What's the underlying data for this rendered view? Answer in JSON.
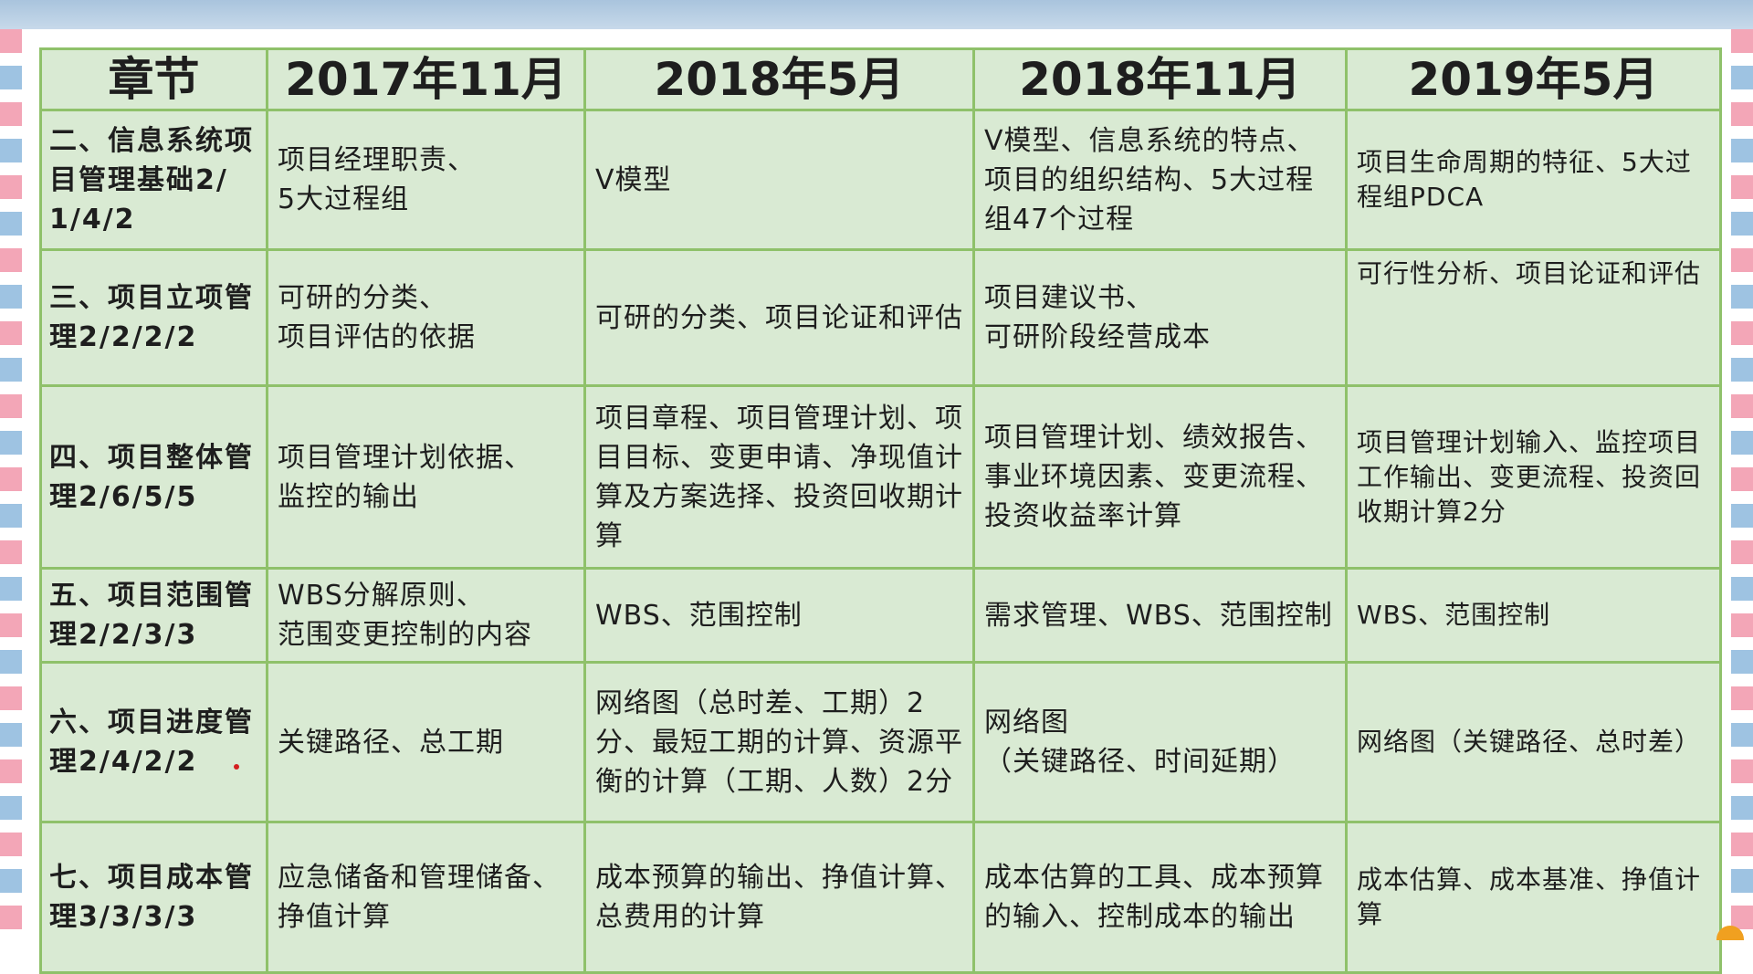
{
  "table": {
    "headers": [
      "章节",
      "2017年11月",
      "2018年5月",
      "2018年11月",
      "2019年5月"
    ],
    "rows": [
      {
        "chapter": "二、信息系统项目管理基础2/1/4/2",
        "c2017_11": "项目经理职责、\n5大过程组",
        "c2018_5": "V模型",
        "c2018_11": "V模型、信息系统的特点、项目的组织结构、5大过程组47个过程",
        "c2019_5": "项目生命周期的特征、5大过程组PDCA"
      },
      {
        "chapter": "三、项目立项管理2/2/2/2",
        "c2017_11": "可研的分类、\n项目评估的依据",
        "c2018_5": "可研的分类、项目论证和评估",
        "c2018_11": "项目建议书、\n可研阶段经营成本",
        "c2019_5": "可行性分析、项目论证和评估"
      },
      {
        "chapter": "四、项目整体管理2/6/5/5",
        "c2017_11": "项目管理计划依据、\n监控的输出",
        "c2018_5": "项目章程、项目管理计划、项目目标、变更申请、净现值计算及方案选择、投资回收期计算",
        "c2018_11": "项目管理计划、绩效报告、事业环境因素、变更流程、投资收益率计算",
        "c2019_5": "项目管理计划输入、监控项目工作输出、变更流程、投资回收期计算2分"
      },
      {
        "chapter": "五、项目范围管理2/2/3/3",
        "c2017_11": "WBS分解原则、\n范围变更控制的内容",
        "c2018_5": "WBS、范围控制",
        "c2018_11": "需求管理、WBS、范围控制",
        "c2019_5": "WBS、范围控制"
      },
      {
        "chapter": "六、项目进度管理2/4/2/2",
        "c2017_11": "关键路径、总工期",
        "c2018_5": "网络图（总时差、工期）2分、最短工期的计算、资源平衡的计算（工期、人数）2分",
        "c2018_11": "网络图\n（关键路径、时间延期）",
        "c2019_5": "网络图（关键路径、总时差）"
      },
      {
        "chapter": "七、项目成本管理3/3/3/3",
        "c2017_11": "应急储备和管理储备、挣值计算",
        "c2018_5": "成本预算的输出、挣值计算、总费用的计算",
        "c2018_11": "成本估算的工具、成本预算的输入、控制成本的输出",
        "c2019_5": "成本估算、成本基准、挣值计算"
      }
    ]
  }
}
